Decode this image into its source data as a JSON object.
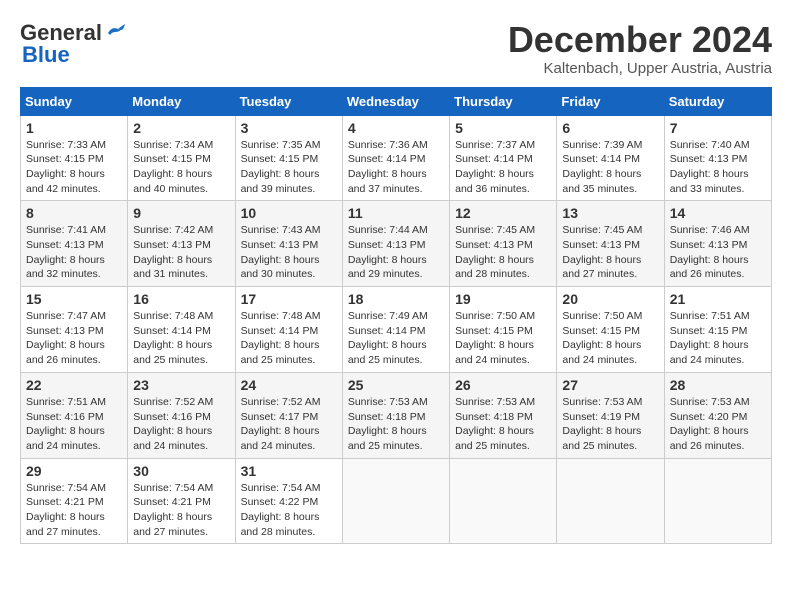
{
  "header": {
    "logo_line1": "General",
    "logo_line2": "Blue",
    "month": "December 2024",
    "location": "Kaltenbach, Upper Austria, Austria"
  },
  "weekdays": [
    "Sunday",
    "Monday",
    "Tuesday",
    "Wednesday",
    "Thursday",
    "Friday",
    "Saturday"
  ],
  "weeks": [
    [
      {
        "day": "1",
        "sunrise": "7:33 AM",
        "sunset": "4:15 PM",
        "daylight": "8 hours and 42 minutes."
      },
      {
        "day": "2",
        "sunrise": "7:34 AM",
        "sunset": "4:15 PM",
        "daylight": "8 hours and 40 minutes."
      },
      {
        "day": "3",
        "sunrise": "7:35 AM",
        "sunset": "4:15 PM",
        "daylight": "8 hours and 39 minutes."
      },
      {
        "day": "4",
        "sunrise": "7:36 AM",
        "sunset": "4:14 PM",
        "daylight": "8 hours and 37 minutes."
      },
      {
        "day": "5",
        "sunrise": "7:37 AM",
        "sunset": "4:14 PM",
        "daylight": "8 hours and 36 minutes."
      },
      {
        "day": "6",
        "sunrise": "7:39 AM",
        "sunset": "4:14 PM",
        "daylight": "8 hours and 35 minutes."
      },
      {
        "day": "7",
        "sunrise": "7:40 AM",
        "sunset": "4:13 PM",
        "daylight": "8 hours and 33 minutes."
      }
    ],
    [
      {
        "day": "8",
        "sunrise": "7:41 AM",
        "sunset": "4:13 PM",
        "daylight": "8 hours and 32 minutes."
      },
      {
        "day": "9",
        "sunrise": "7:42 AM",
        "sunset": "4:13 PM",
        "daylight": "8 hours and 31 minutes."
      },
      {
        "day": "10",
        "sunrise": "7:43 AM",
        "sunset": "4:13 PM",
        "daylight": "8 hours and 30 minutes."
      },
      {
        "day": "11",
        "sunrise": "7:44 AM",
        "sunset": "4:13 PM",
        "daylight": "8 hours and 29 minutes."
      },
      {
        "day": "12",
        "sunrise": "7:45 AM",
        "sunset": "4:13 PM",
        "daylight": "8 hours and 28 minutes."
      },
      {
        "day": "13",
        "sunrise": "7:45 AM",
        "sunset": "4:13 PM",
        "daylight": "8 hours and 27 minutes."
      },
      {
        "day": "14",
        "sunrise": "7:46 AM",
        "sunset": "4:13 PM",
        "daylight": "8 hours and 26 minutes."
      }
    ],
    [
      {
        "day": "15",
        "sunrise": "7:47 AM",
        "sunset": "4:13 PM",
        "daylight": "8 hours and 26 minutes."
      },
      {
        "day": "16",
        "sunrise": "7:48 AM",
        "sunset": "4:14 PM",
        "daylight": "8 hours and 25 minutes."
      },
      {
        "day": "17",
        "sunrise": "7:48 AM",
        "sunset": "4:14 PM",
        "daylight": "8 hours and 25 minutes."
      },
      {
        "day": "18",
        "sunrise": "7:49 AM",
        "sunset": "4:14 PM",
        "daylight": "8 hours and 25 minutes."
      },
      {
        "day": "19",
        "sunrise": "7:50 AM",
        "sunset": "4:15 PM",
        "daylight": "8 hours and 24 minutes."
      },
      {
        "day": "20",
        "sunrise": "7:50 AM",
        "sunset": "4:15 PM",
        "daylight": "8 hours and 24 minutes."
      },
      {
        "day": "21",
        "sunrise": "7:51 AM",
        "sunset": "4:15 PM",
        "daylight": "8 hours and 24 minutes."
      }
    ],
    [
      {
        "day": "22",
        "sunrise": "7:51 AM",
        "sunset": "4:16 PM",
        "daylight": "8 hours and 24 minutes."
      },
      {
        "day": "23",
        "sunrise": "7:52 AM",
        "sunset": "4:16 PM",
        "daylight": "8 hours and 24 minutes."
      },
      {
        "day": "24",
        "sunrise": "7:52 AM",
        "sunset": "4:17 PM",
        "daylight": "8 hours and 24 minutes."
      },
      {
        "day": "25",
        "sunrise": "7:53 AM",
        "sunset": "4:18 PM",
        "daylight": "8 hours and 25 minutes."
      },
      {
        "day": "26",
        "sunrise": "7:53 AM",
        "sunset": "4:18 PM",
        "daylight": "8 hours and 25 minutes."
      },
      {
        "day": "27",
        "sunrise": "7:53 AM",
        "sunset": "4:19 PM",
        "daylight": "8 hours and 25 minutes."
      },
      {
        "day": "28",
        "sunrise": "7:53 AM",
        "sunset": "4:20 PM",
        "daylight": "8 hours and 26 minutes."
      }
    ],
    [
      {
        "day": "29",
        "sunrise": "7:54 AM",
        "sunset": "4:21 PM",
        "daylight": "8 hours and 27 minutes."
      },
      {
        "day": "30",
        "sunrise": "7:54 AM",
        "sunset": "4:21 PM",
        "daylight": "8 hours and 27 minutes."
      },
      {
        "day": "31",
        "sunrise": "7:54 AM",
        "sunset": "4:22 PM",
        "daylight": "8 hours and 28 minutes."
      },
      null,
      null,
      null,
      null
    ]
  ],
  "labels": {
    "sunrise": "Sunrise:",
    "sunset": "Sunset:",
    "daylight": "Daylight:"
  }
}
